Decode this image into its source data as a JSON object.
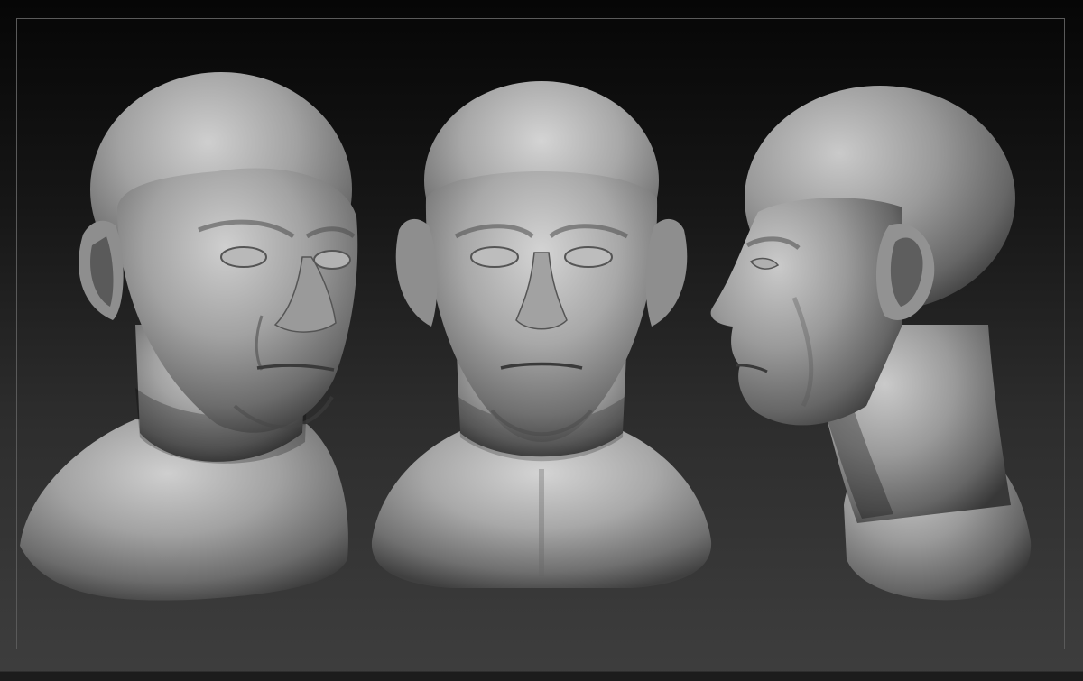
{
  "scene": {
    "subject": "sculpted-head-three-views",
    "views": [
      {
        "id": "three-quarter",
        "label": ""
      },
      {
        "id": "front",
        "label": ""
      },
      {
        "id": "profile",
        "label": ""
      }
    ],
    "colors": {
      "background_top": "#060606",
      "background_bottom": "#3e3e3e",
      "frame": "#5a5a5a",
      "clay_light": "#c9c9c9",
      "clay_mid": "#8e8e8e",
      "clay_dark": "#3a3a3a"
    }
  }
}
